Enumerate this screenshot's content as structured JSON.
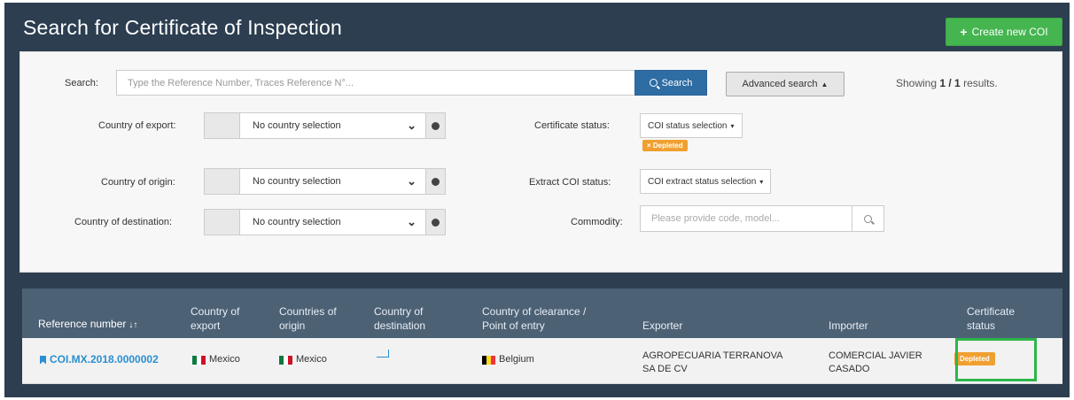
{
  "header": {
    "title": "Search for Certificate of Inspection",
    "create_button": "Create new COI"
  },
  "search": {
    "label": "Search:",
    "placeholder": "Type the Reference Number, Traces Reference N°...",
    "button": "Search",
    "advanced_button": "Advanced search",
    "results_prefix": "Showing ",
    "results_count": "1 / 1",
    "results_suffix": " results."
  },
  "filters": {
    "country_of_export": {
      "label": "Country of export:",
      "value": "No country selection"
    },
    "country_of_origin": {
      "label": "Country of origin:",
      "value": "No country selection"
    },
    "country_of_destination": {
      "label": "Country of destination:",
      "value": "No country selection"
    },
    "certificate_status": {
      "label": "Certificate status:",
      "value": "COI status selection",
      "tag": "Depleted"
    },
    "extract_coi_status": {
      "label": "Extract COI status:",
      "value": "COI extract status selection"
    },
    "commodity": {
      "label": "Commodity:",
      "placeholder": "Please provide code, model..."
    }
  },
  "table": {
    "headers": {
      "reference": "Reference number",
      "export_line1": "Country of",
      "export_line2": "export",
      "origin_line1": "Countries of",
      "origin_line2": "origin",
      "destination_line1": "Country of",
      "destination_line2": "destination",
      "clearance_line1": "Country of clearance /",
      "clearance_line2": "Point of entry",
      "exporter": "Exporter",
      "importer": "Importer",
      "status_line1": "Certificate",
      "status_line2": "status"
    },
    "rows": [
      {
        "reference": "COI.MX.2018.0000002",
        "country_of_export": "Mexico",
        "countries_of_origin": "Mexico",
        "country_of_clearance": "Belgium",
        "exporter_line1": "AGROPECUARIA TERRANOVA",
        "exporter_line2": "SA DE CV",
        "importer_line1": "COMERCIAL JAVIER",
        "importer_line2": "CASADO",
        "status": "Depleted"
      }
    ]
  },
  "colors": {
    "background": "#2c3e50",
    "create_button": "#45b54f",
    "search_button": "#2e6da4",
    "depleted_badge": "#f0a030",
    "link": "#2a8fd0",
    "highlight": "#2db54a"
  }
}
